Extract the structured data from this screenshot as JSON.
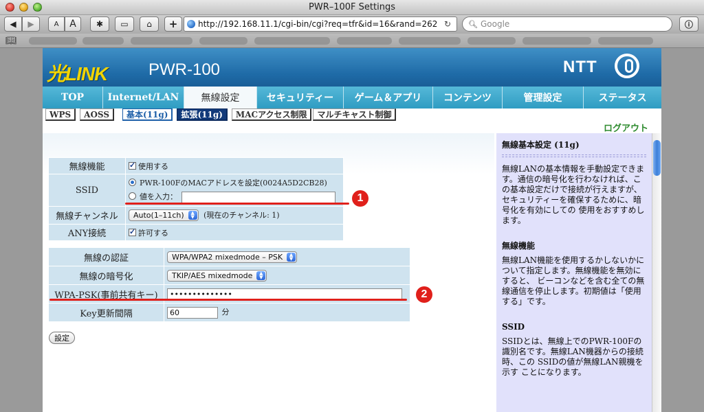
{
  "window": {
    "title": "PWR–100F Settings"
  },
  "browser": {
    "url": "http://192.168.11.1/cgi-bin/cgi?req=tfr&id=16&rand=262",
    "search_placeholder": "Google",
    "btn_small_a": "A",
    "btn_large_a": "A",
    "btn_plus": "+"
  },
  "header": {
    "logo": "光LINK",
    "model": "PWR-100",
    "brand": "NTT"
  },
  "nav": {
    "tabs": [
      "TOP",
      "Internet/LAN",
      "無線設定",
      "セキュリティー",
      "ゲーム＆アプリ",
      "コンテンツ",
      "管理設定",
      "ステータス"
    ],
    "active": 2
  },
  "subnav": [
    "WPS",
    "AOSS",
    "基本(11g)",
    "拡張(11g)",
    "MACアクセス制限",
    "マルチキャスト制御"
  ],
  "logout": "ログアウト",
  "form1": {
    "wireless_label": "無線機能",
    "wireless_value": "使用する",
    "ssid_label": "SSID",
    "ssid_option1": "PWR-100FのMACアドレスを設定(0024A5D2CB28)",
    "ssid_option2": "値を入力：",
    "channel_label": "無線チャンネル",
    "channel_value": "Auto(1–11ch)",
    "channel_current": "(現在のチャンネル: 1)",
    "any_label": "ANY接続",
    "any_value": "許可する"
  },
  "form2": {
    "auth_label": "無線の認証",
    "auth_value": "WPA/WPA2 mixedmode – PSK",
    "enc_label": "無線の暗号化",
    "enc_value": "TKIP/AES mixedmode",
    "psk_label": "WPA-PSK(事前共有キー)",
    "psk_value": "••••••••••••••",
    "key_label": "Key更新間隔",
    "key_value": "60",
    "key_unit": "分"
  },
  "submit": "設定",
  "badges": {
    "one": "1",
    "two": "2"
  },
  "help": {
    "title": "無線基本設定 (11g)",
    "intro": "無線LANの基本情報を手動設定できます。通信の暗号化を行わなければ、この基本設定だけで接続が行えますが、セキュリティーを確保するために、暗号化を有効にしての 使用をおすすめします。",
    "h_wireless": "無線機能",
    "p_wireless": "無線LAN機能を使用するかしないかについて指定します。無線機能を無効にすると、 ビーコンなどを含む全ての無線通信を停止します。初期値は「使用する」です。",
    "h_ssid": "SSID",
    "p_ssid": "SSIDとは、無線上でのPWR-100Fの識別名です。無線LAN機器からの接続時、この SSIDの値が無線LAN親機を示す ことになります。"
  },
  "colors": {
    "accent_red": "#e0201b",
    "nav_blue": "#3aa5c9",
    "help_bg": "#e1e1fb",
    "logout_green": "#2e8b2e"
  }
}
